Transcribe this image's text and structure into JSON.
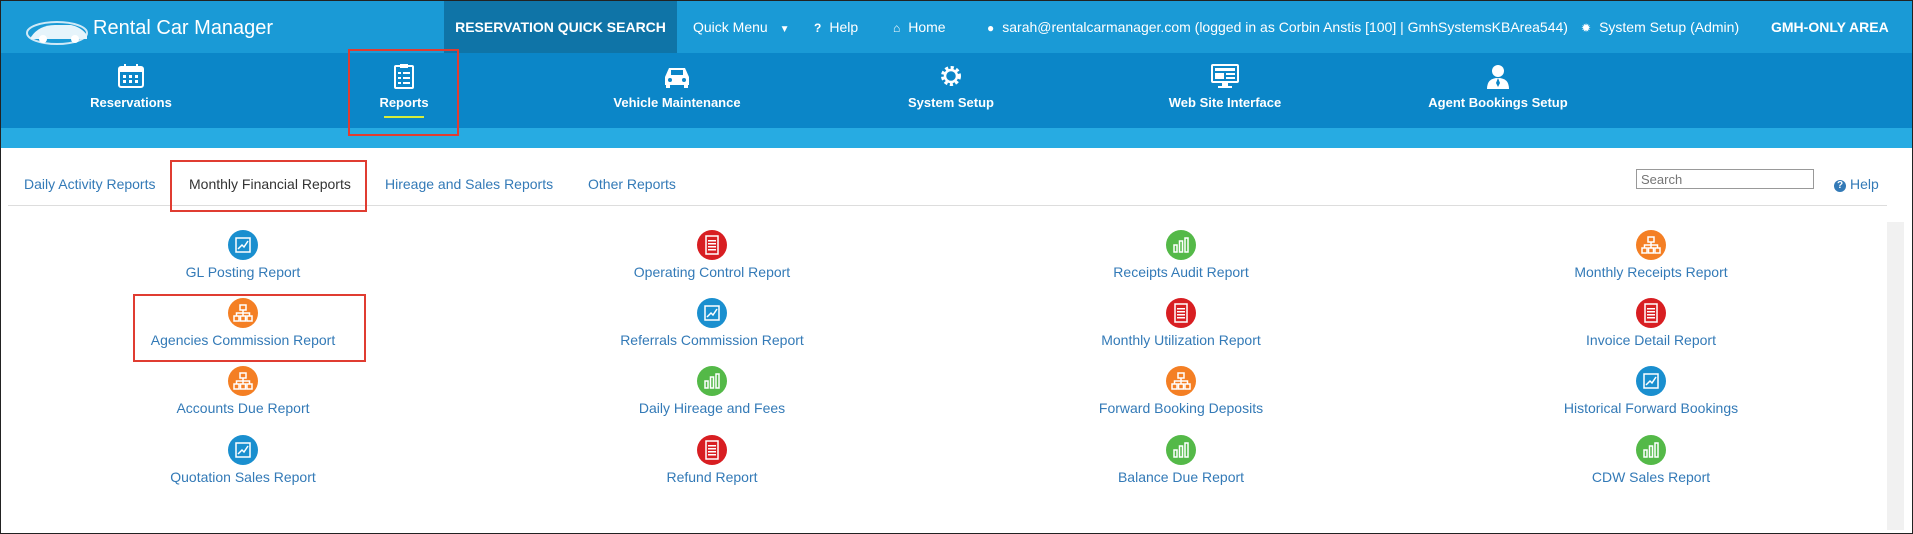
{
  "app": {
    "title": "Rental Car Manager"
  },
  "topnav": {
    "quick_search": "RESERVATION QUICK SEARCH",
    "quick_menu": "Quick Menu",
    "help": "Help",
    "home": "Home",
    "user": "sarah@rentalcarmanager.com (logged in as Corbin Anstis [100] | GmhSystemsKBArea544)",
    "system_setup": "System Setup (Admin)",
    "gmh_area": "GMH-ONLY AREA"
  },
  "modules": [
    {
      "label": "Reservations",
      "icon": "calendar-icon"
    },
    {
      "label": "Reports",
      "icon": "clipboard-checklist-icon"
    },
    {
      "label": "Vehicle Maintenance",
      "icon": "car-icon"
    },
    {
      "label": "System Setup",
      "icon": "gear-icon"
    },
    {
      "label": "Web Site Interface",
      "icon": "monitor-icon"
    },
    {
      "label": "Agent Bookings Setup",
      "icon": "agent-user-icon"
    }
  ],
  "tabs": [
    "Daily Activity Reports",
    "Monthly Financial Reports",
    "Hireage and Sales Reports",
    "Other Reports"
  ],
  "search": {
    "placeholder": "Search"
  },
  "help_link": "Help",
  "reports": [
    [
      {
        "label": "GL Posting Report",
        "color": "#1a8fcf",
        "icon": "line-chart-icon"
      },
      {
        "label": "Agencies Commission Report",
        "color": "#f47f24",
        "icon": "org-chart-icon"
      },
      {
        "label": "Accounts Due Report",
        "color": "#f47f24",
        "icon": "org-chart-icon"
      },
      {
        "label": "Quotation Sales Report",
        "color": "#1a8fcf",
        "icon": "line-chart-icon"
      }
    ],
    [
      {
        "label": "Operating Control Report",
        "color": "#d81e22",
        "icon": "document-icon"
      },
      {
        "label": "Referrals Commission Report",
        "color": "#1a8fcf",
        "icon": "line-chart-icon"
      },
      {
        "label": "Daily Hireage and Fees",
        "color": "#54b948",
        "icon": "bar-chart-icon"
      },
      {
        "label": "Refund Report",
        "color": "#d81e22",
        "icon": "document-icon"
      }
    ],
    [
      {
        "label": "Receipts Audit Report",
        "color": "#54b948",
        "icon": "bar-chart-icon"
      },
      {
        "label": "Monthly Utilization Report",
        "color": "#d81e22",
        "icon": "document-icon"
      },
      {
        "label": "Forward Booking Deposits",
        "color": "#f47f24",
        "icon": "org-chart-icon"
      },
      {
        "label": "Balance Due Report",
        "color": "#54b948",
        "icon": "bar-chart-icon"
      }
    ],
    [
      {
        "label": "Monthly Receipts Report",
        "color": "#f47f24",
        "icon": "org-chart-icon"
      },
      {
        "label": "Invoice Detail Report",
        "color": "#d81e22",
        "icon": "document-icon"
      },
      {
        "label": "Historical Forward Bookings",
        "color": "#1a8fcf",
        "icon": "line-chart-icon"
      },
      {
        "label": "CDW Sales Report",
        "color": "#54b948",
        "icon": "bar-chart-icon"
      }
    ]
  ],
  "colors": {
    "topbar": "#1a9ad6",
    "modbar": "#0b86c8",
    "highlight": "#e03c31",
    "link": "#337ab7"
  }
}
